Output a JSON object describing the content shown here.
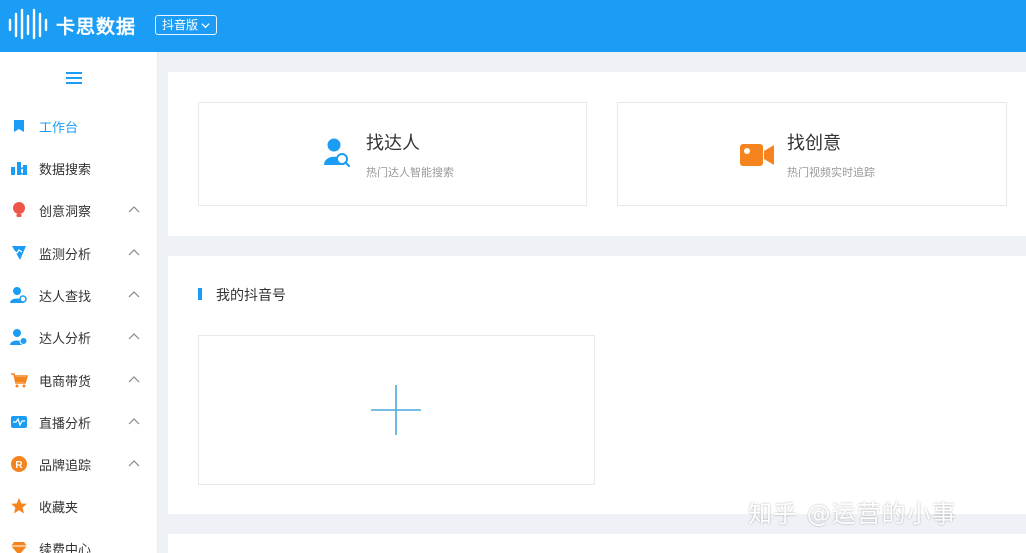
{
  "app": {
    "brand": "卡思数据",
    "edition": "抖音版"
  },
  "sidebar": {
    "items": [
      {
        "label": "工作台",
        "icon": "bookmark-icon",
        "active": true,
        "expandable": false
      },
      {
        "label": "数据搜索",
        "icon": "bar-chart-icon",
        "active": false,
        "expandable": false
      },
      {
        "label": "创意洞察",
        "icon": "bulb-icon",
        "active": false,
        "expandable": true
      },
      {
        "label": "监测分析",
        "icon": "monitor-icon",
        "active": false,
        "expandable": true
      },
      {
        "label": "达人查找",
        "icon": "user-search-icon",
        "active": false,
        "expandable": true
      },
      {
        "label": "达人分析",
        "icon": "user-check-icon",
        "active": false,
        "expandable": true
      },
      {
        "label": "电商带货",
        "icon": "cart-icon",
        "active": false,
        "expandable": true
      },
      {
        "label": "直播分析",
        "icon": "live-icon",
        "active": false,
        "expandable": true
      },
      {
        "label": "品牌追踪",
        "icon": "brand-icon",
        "active": false,
        "expandable": true
      },
      {
        "label": "收藏夹",
        "icon": "star-icon",
        "active": false,
        "expandable": false
      },
      {
        "label": "续费中心",
        "icon": "diamond-icon",
        "active": false,
        "expandable": false
      }
    ]
  },
  "cards": {
    "find_talent": {
      "title": "找达人",
      "subtitle": "热门达人智能搜索",
      "icon": "user-search-icon"
    },
    "find_idea": {
      "title": "找创意",
      "subtitle": "热门视频实时追踪",
      "icon": "video-camera-icon"
    }
  },
  "section": {
    "title": "我的抖音号"
  },
  "watermark": "知乎 @运营的小事",
  "colors": {
    "primary": "#1b9df5",
    "orange": "#f5841f",
    "red": "#f0554a"
  }
}
